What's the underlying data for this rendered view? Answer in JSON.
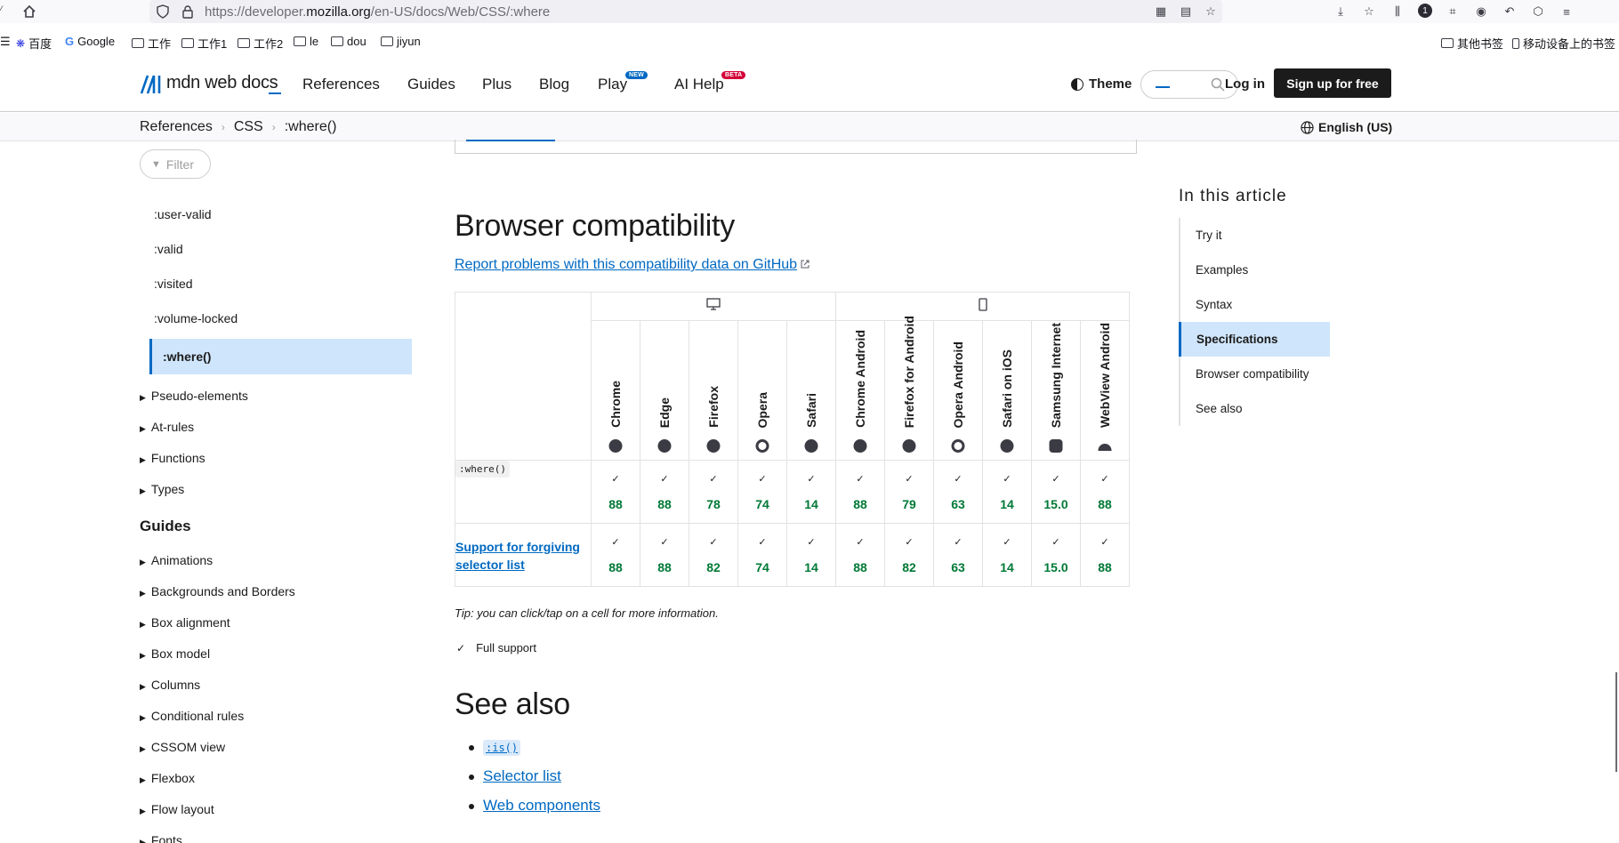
{
  "browser": {
    "url_prefix": "https://developer.",
    "url_domain": "mozilla.org",
    "url_path": "/en-US/docs/Web/CSS/:where",
    "bookmarks": [
      {
        "label": "百度",
        "kind": "baidu"
      },
      {
        "label": "Google",
        "kind": "google"
      },
      {
        "label": "工作",
        "kind": "folder"
      },
      {
        "label": "工作1",
        "kind": "folder"
      },
      {
        "label": "工作2",
        "kind": "folder"
      },
      {
        "label": "le",
        "kind": "folder"
      },
      {
        "label": "dou",
        "kind": "folder"
      },
      {
        "label": "jiyun",
        "kind": "folder"
      }
    ],
    "bookmarks_right": {
      "other": "其他书签",
      "mobile": "移动设备上的书签"
    }
  },
  "header": {
    "logo": "mdn web docs",
    "nav": {
      "references": "References",
      "guides": "Guides",
      "plus": "Plus",
      "blog": "Blog",
      "play": "Play",
      "ai_help": "AI Help"
    },
    "badges": {
      "new": "NEW",
      "beta": "BETA"
    },
    "theme": "Theme",
    "login": "Log in",
    "signup": "Sign up for free"
  },
  "breadcrumb": {
    "items": [
      "References",
      "CSS",
      ":where()"
    ],
    "language": "English (US)"
  },
  "sidebar": {
    "filter": "Filter",
    "pseudo_items": [
      ":user-valid",
      ":valid",
      ":visited",
      ":volume-locked"
    ],
    "active_item": ":where()",
    "sections": [
      "Pseudo-elements",
      "At-rules",
      "Functions",
      "Types"
    ],
    "guides_heading": "Guides",
    "guides": [
      "Animations",
      "Backgrounds and Borders",
      "Box alignment",
      "Box model",
      "Columns",
      "Conditional rules",
      "CSSOM view",
      "Flexbox",
      "Flow layout",
      "Fonts"
    ]
  },
  "main": {
    "compat_heading": "Browser compatibility",
    "compat_link": "Report problems with this compatibility data on GitHub",
    "browsers": [
      "Chrome",
      "Edge",
      "Firefox",
      "Opera",
      "Safari",
      "Chrome Android",
      "Firefox for Android",
      "Opera Android",
      "Safari on iOS",
      "Samsung Internet",
      "WebView Android"
    ],
    "rows": [
      {
        "feature": ":where()",
        "is_code": true,
        "versions": [
          "88",
          "88",
          "78",
          "74",
          "14",
          "88",
          "79",
          "63",
          "14",
          "15.0",
          "88"
        ]
      },
      {
        "feature": "Support for forgiving selector list",
        "is_code": false,
        "versions": [
          "88",
          "88",
          "82",
          "74",
          "14",
          "88",
          "82",
          "63",
          "14",
          "15.0",
          "88"
        ]
      }
    ],
    "tip": "Tip: you can click/tap on a cell for more information.",
    "legend_full": "Full support",
    "seealso_heading": "See also",
    "seealso": [
      {
        "label": ":is()",
        "is_code": true
      },
      {
        "label": "Selector list",
        "is_code": false
      },
      {
        "label": "Web components",
        "is_code": false
      }
    ]
  },
  "toc": {
    "title": "In this article",
    "items": [
      "Try it",
      "Examples",
      "Syntax",
      "Specifications",
      "Browser compatibility",
      "See also"
    ],
    "active": "Specifications"
  },
  "colors": {
    "accent": "#0069c2",
    "support": "#007936",
    "active_bg": "#cfe5fb"
  }
}
